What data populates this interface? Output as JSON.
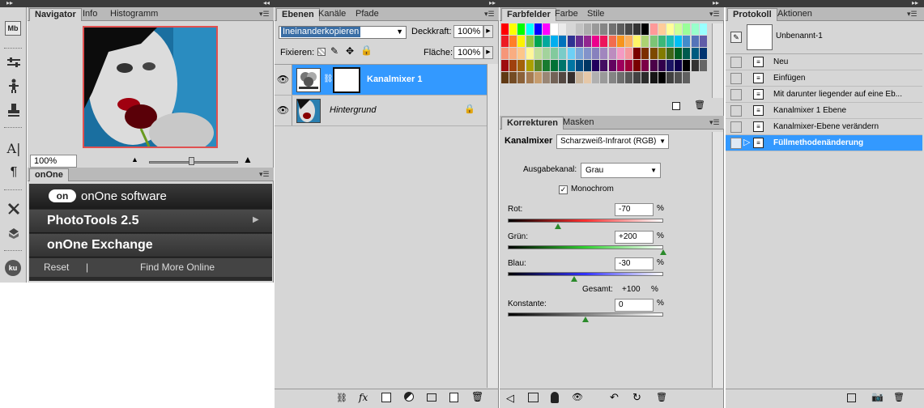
{
  "navigator": {
    "tabs": [
      "Navigator",
      "Info",
      "Histogramm"
    ],
    "zoom": "100%"
  },
  "onone": {
    "tab": "onOne",
    "logo_text": "onOne software",
    "items": [
      "PhotoTools 2.5",
      "onOne Exchange"
    ],
    "reset": "Reset",
    "separator": "|",
    "find_more": "Find More Online"
  },
  "layers": {
    "tabs": [
      "Ebenen",
      "Kanäle",
      "Pfade"
    ],
    "blend_mode": "Ineinanderkopieren",
    "opacity_label": "Deckkraft:",
    "opacity": "100%",
    "lock_label": "Fixieren:",
    "fill_label": "Fläche:",
    "fill": "100%",
    "rows": [
      {
        "name": "Kanalmixer 1"
      },
      {
        "name": "Hintergrund"
      }
    ]
  },
  "swatches": {
    "tabs": [
      "Farbfelder",
      "Farbe",
      "Stile"
    ],
    "colors": [
      [
        "#ff0000",
        "#ffff00",
        "#00ff00",
        "#00ffff",
        "#0000ff",
        "#ff00ff",
        "#ffffff",
        "#ebebeb",
        "#d6d6d6",
        "#c2c2c2",
        "#adadad",
        "#999999",
        "#858585",
        "#707070",
        "#5c5c5c",
        "#474747",
        "#333333",
        "#000000",
        "#ff9999",
        "#ffcc99",
        "#ffff99",
        "#ccff99",
        "#99ff99",
        "#99ffcc",
        "#99ffff"
      ],
      [
        "#ed1c24",
        "#ff7f27",
        "#fff200",
        "#8dc63f",
        "#00a651",
        "#00a99d",
        "#00aeef",
        "#0072bc",
        "#2e3192",
        "#662d91",
        "#92278f",
        "#ec008c",
        "#ed145b",
        "#f26c4f",
        "#f7941d",
        "#fbaf5d",
        "#fff568",
        "#acd373",
        "#7cc576",
        "#3bb878",
        "#1abbb4",
        "#00bff3",
        "#438ccb",
        "#5574b9",
        "#605ca8"
      ],
      [
        "#f69679",
        "#f9ad81",
        "#fdc689",
        "#fff799",
        "#c4df9b",
        "#a3d39c",
        "#82ca9d",
        "#7accc8",
        "#6dcff6",
        "#7da7d9",
        "#8393ca",
        "#8781bd",
        "#a186be",
        "#bd8cbf",
        "#f49ac2",
        "#f5989d",
        "#790000",
        "#7b2e00",
        "#7d4900",
        "#827b00",
        "#406618",
        "#005e20",
        "#005b4f",
        "#005a7f",
        "#003471"
      ],
      [
        "#9e0b0f",
        "#a0410d",
        "#a3620a",
        "#aba000",
        "#598527",
        "#197b30",
        "#007236",
        "#00746b",
        "#0076a3",
        "#004a80",
        "#003663",
        "#21005d",
        "#440e62",
        "#630460",
        "#9e005d",
        "#9e0039",
        "#790000",
        "#7b0046",
        "#4b0049",
        "#32004b",
        "#1b1464",
        "#0d004c",
        "#000000",
        "#333333",
        "#666666"
      ],
      [
        "#603913",
        "#754c24",
        "#8c6239",
        "#a67c52",
        "#c69c6d",
        "#998675",
        "#736357",
        "#534741",
        "#362f2d",
        "#c7b299",
        "#e6c8a8",
        "#b0b0b0",
        "#9a9a9a",
        "#848484",
        "#6e6e6e",
        "#585858",
        "#424242",
        "#2c2c2c",
        "#161616",
        "#000000",
        "#404040",
        "#505050",
        "#606060"
      ]
    ]
  },
  "adjustments": {
    "tabs": [
      "Korrekturen",
      "Masken"
    ],
    "title": "Kanalmixer",
    "preset": "Scharzweiß-Infrarot (RGB)",
    "output_label": "Ausgabekanal:",
    "output_value": "Grau",
    "monochrome_label": "Monochrom",
    "monochrome_checked": true,
    "red_label": "Rot:",
    "red_value": "-70",
    "red_level": -70,
    "green_label": "Grün:",
    "green_value": "+200",
    "green_level": 200,
    "blue_label": "Blau:",
    "blue_value": "-30",
    "blue_level": -30,
    "percent": "%",
    "total_label": "Gesamt:",
    "total_value": "+100",
    "constant_label": "Konstante:",
    "constant_value": "0",
    "constant_level": 0
  },
  "history": {
    "tabs": [
      "Protokoll",
      "Aktionen"
    ],
    "snapshot": "Unbenannt-1",
    "items": [
      "Neu",
      "Einfügen",
      "Mit darunter liegender auf eine Eb...",
      "Kanalmixer 1 Ebene",
      "Kanalmixer-Ebene verändern",
      "Füllmethodenänderung"
    ],
    "selected_index": 5
  },
  "tools": {
    "icons": [
      "mini-bridge-icon",
      "adjust-icon",
      "puppet-icon",
      "stamp-icon",
      "character-icon",
      "paragraph-icon",
      "tools-icon",
      "3d-icon",
      "kuler-icon"
    ],
    "mb_text": "Mb",
    "ku_text": "ku"
  }
}
